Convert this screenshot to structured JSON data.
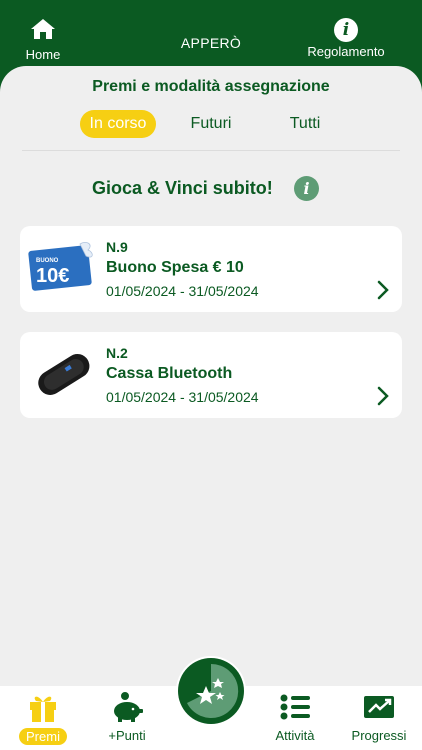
{
  "header": {
    "home_label": "Home",
    "title": "APPERÒ",
    "rules_label": "Regolamento"
  },
  "section": {
    "title": "Premi e modalità assegnazione"
  },
  "tabs": [
    {
      "label": "In corso",
      "active": true
    },
    {
      "label": "Futuri",
      "active": false
    },
    {
      "label": "Tutti",
      "active": false
    }
  ],
  "game": {
    "title": "Gioca & Vinci subito!"
  },
  "prizes": [
    {
      "number": "N.9",
      "name": "Buono Spesa € 10",
      "dates": "01/05/2024 - 31/05/2024",
      "icon": "voucher-image",
      "voucher_top": "BUONO",
      "voucher_amount": "10€"
    },
    {
      "number": "N.2",
      "name": "Cassa Bluetooth",
      "dates": "01/05/2024 - 31/05/2024",
      "icon": "bluetooth-speaker-image"
    }
  ],
  "bottom_nav": [
    {
      "label": "Premi",
      "icon": "gift-icon",
      "active": true
    },
    {
      "label": "+Punti",
      "icon": "piggy-bank-icon",
      "active": false
    },
    {
      "label": "Attività",
      "icon": "list-icon",
      "active": false
    },
    {
      "label": "Progressi",
      "icon": "chart-up-icon",
      "active": false
    }
  ],
  "colors": {
    "brand_green": "#0b5a22",
    "accent_yellow": "#f6cf13",
    "background": "#efefef"
  }
}
